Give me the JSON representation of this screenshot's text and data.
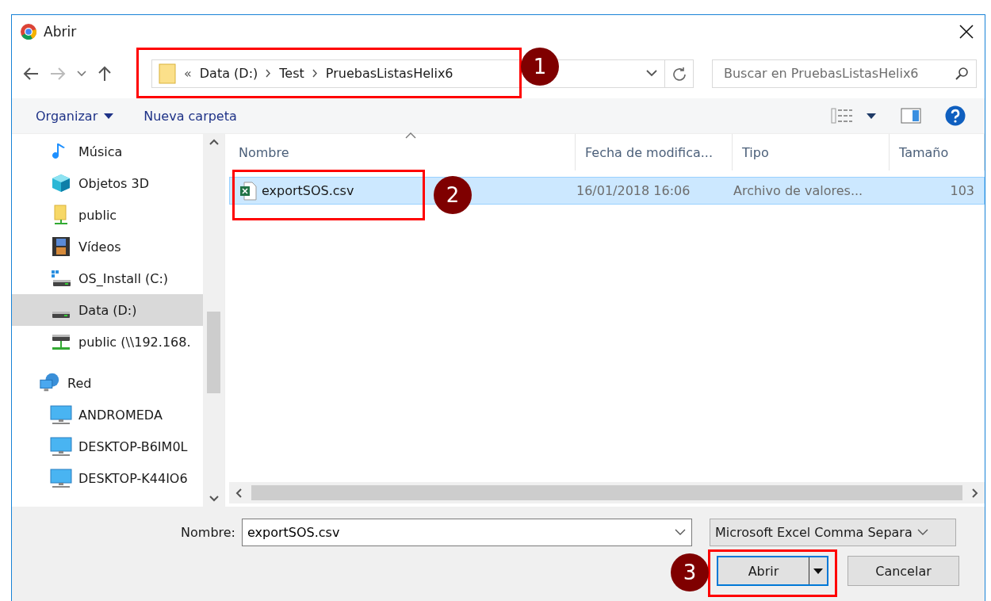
{
  "window": {
    "title": "Abrir"
  },
  "address": {
    "overflow": "«",
    "crumbs": [
      "Data (D:)",
      "Test",
      "PruebasListasHelix6"
    ]
  },
  "search": {
    "placeholder": "Buscar en PruebasListasHelix6"
  },
  "toolbar": {
    "organize": "Organizar",
    "new_folder": "Nueva carpeta"
  },
  "sidebar": {
    "items": [
      {
        "label": "Música",
        "kind": "music",
        "selected": false
      },
      {
        "label": "Objetos 3D",
        "kind": "cube",
        "selected": false
      },
      {
        "label": "public",
        "kind": "userfolder",
        "selected": false
      },
      {
        "label": "Vídeos",
        "kind": "video",
        "selected": false
      },
      {
        "label": "OS_Install (C:)",
        "kind": "osdrive",
        "selected": false
      },
      {
        "label": "Data (D:)",
        "kind": "drive",
        "selected": true
      },
      {
        "label": "public (\\\\192.168.",
        "kind": "netdrive",
        "selected": false
      },
      {
        "label": "Red",
        "kind": "network",
        "selected": false,
        "children": [
          {
            "label": "ANDROMEDA",
            "kind": "computer",
            "selected": false
          },
          {
            "label": "DESKTOP-B6IM0L",
            "kind": "computer",
            "selected": false
          },
          {
            "label": "DESKTOP-K44IO6",
            "kind": "computer",
            "selected": false
          }
        ]
      }
    ]
  },
  "table": {
    "columns": [
      "Nombre",
      "Fecha de modifica...",
      "Tipo",
      "Tamaño"
    ],
    "rows": [
      {
        "name": "exportSOS.csv",
        "date": "16/01/2018 16:06",
        "type": "Archivo de valores...",
        "size": "103",
        "selected": true
      }
    ]
  },
  "footer": {
    "name_label": "Nombre:",
    "name_value": "exportSOS.csv",
    "filter": "Microsoft Excel Comma Separa",
    "open": "Abrir",
    "cancel": "Cancelar"
  },
  "annotations": [
    "1",
    "2",
    "3"
  ]
}
